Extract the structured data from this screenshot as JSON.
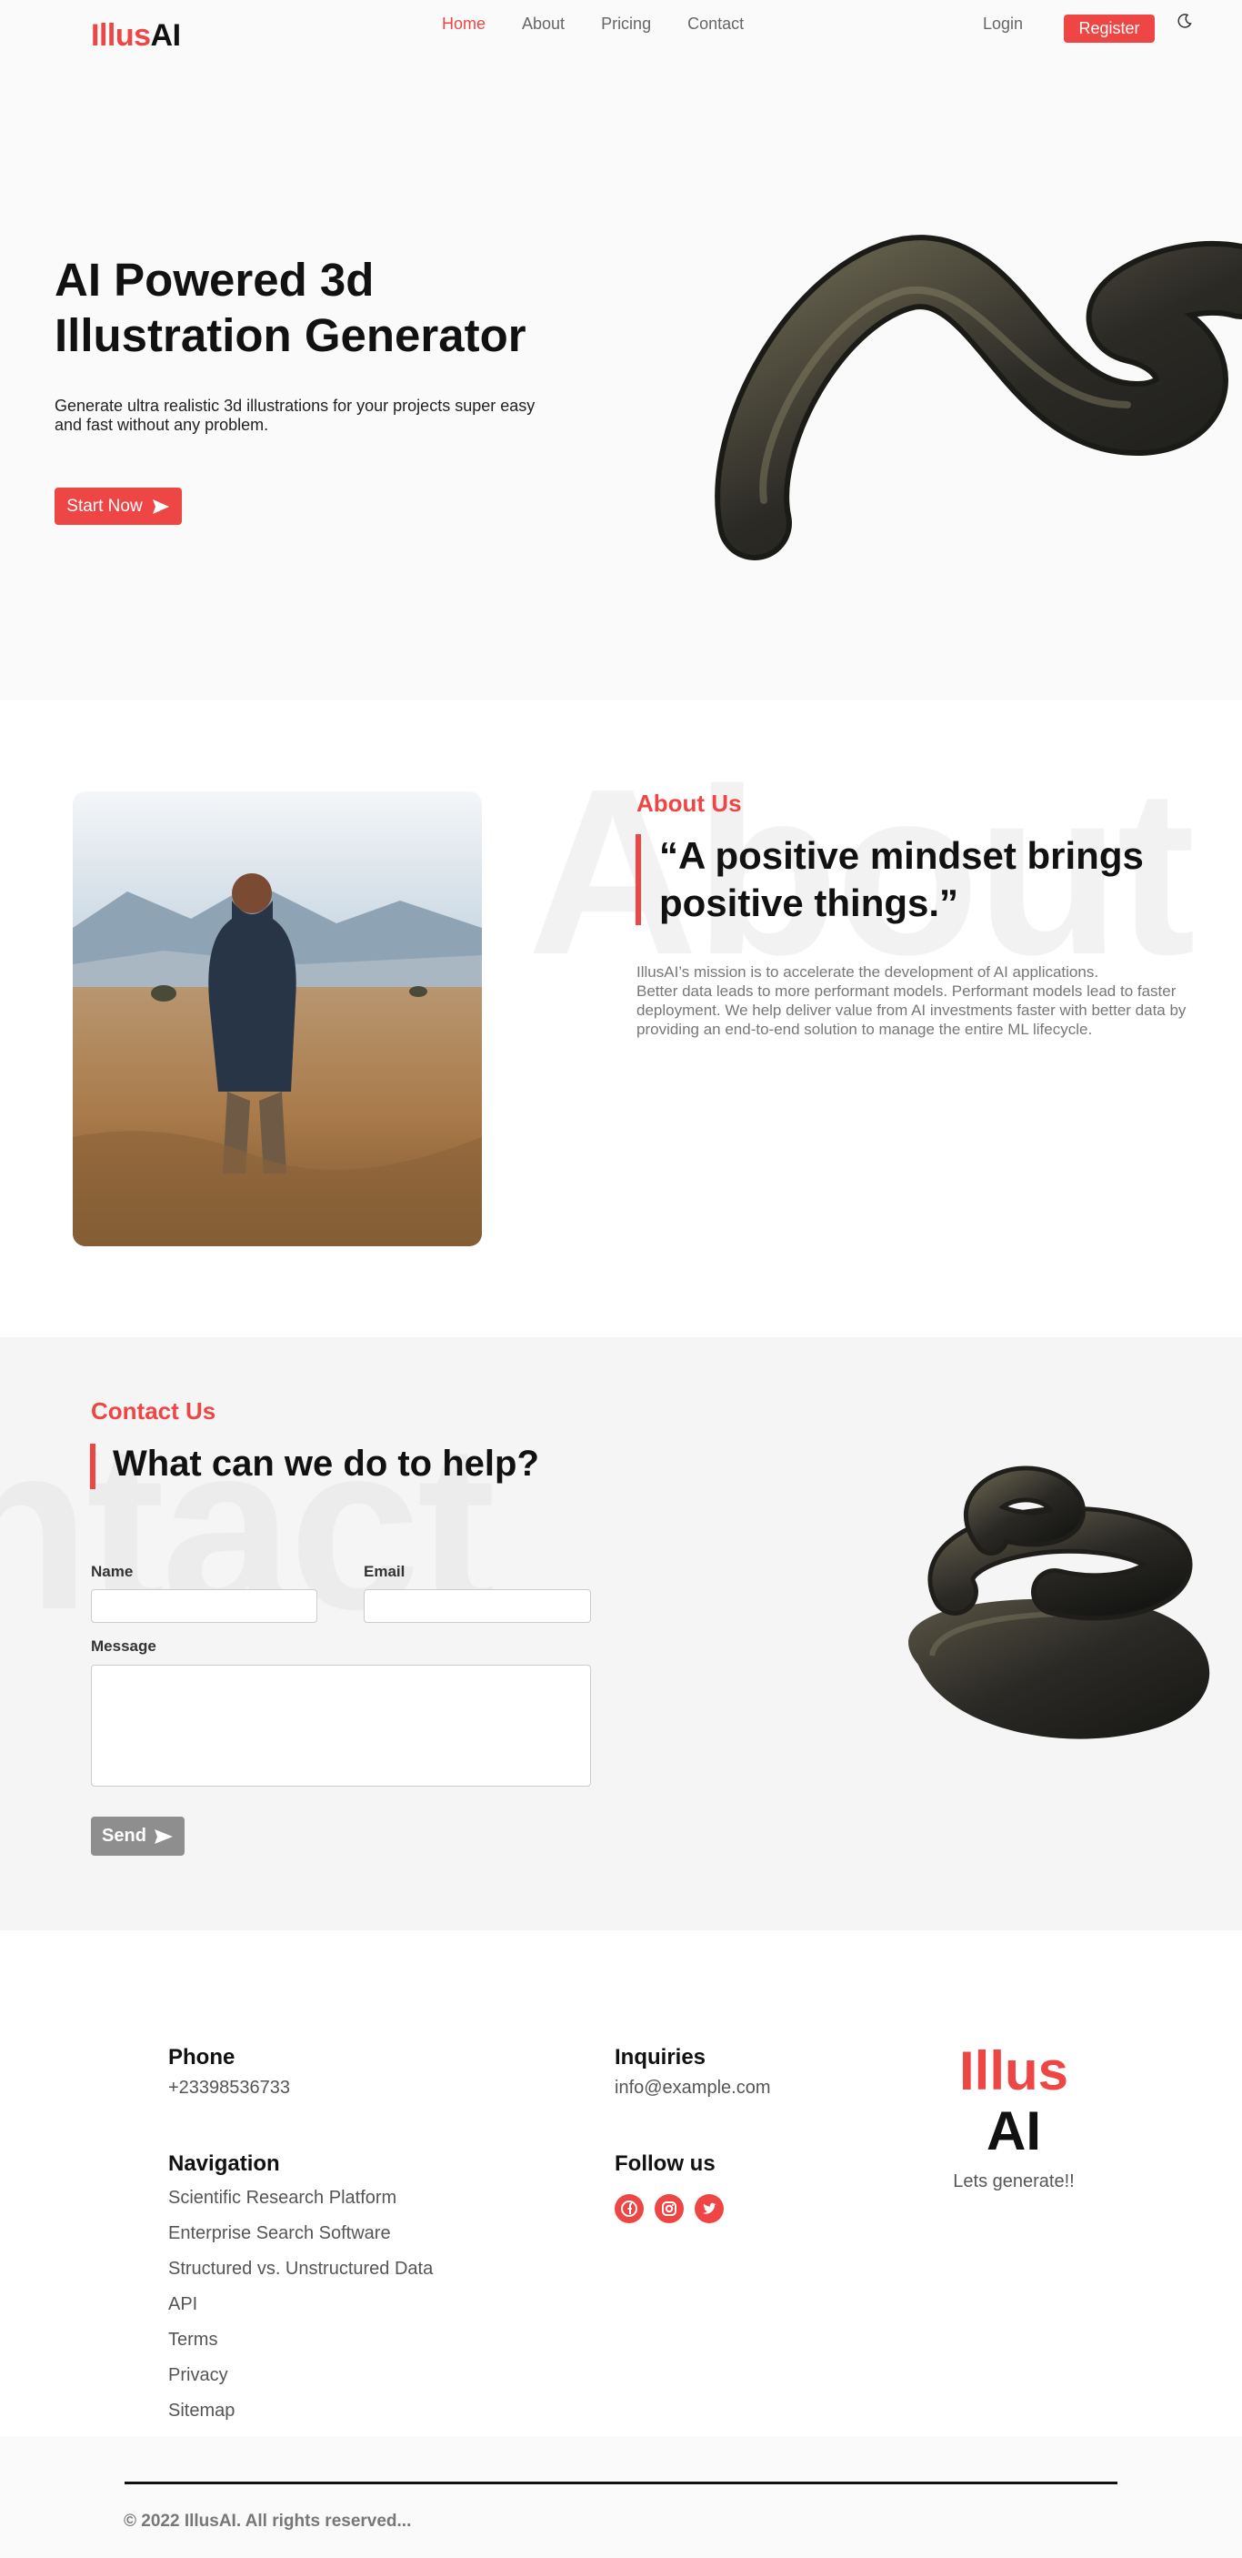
{
  "nav": {
    "logo_red": "Illus",
    "logo_dark": "AI",
    "links": [
      "Home",
      "About",
      "Pricing",
      "Contact"
    ],
    "login": "Login",
    "register": "Register"
  },
  "hero": {
    "title": "AI Powered 3d Illustration Generator",
    "description": "Generate ultra realistic 3d illustrations for your projects super easy and fast without any problem.",
    "cta": "Start Now"
  },
  "about": {
    "watermark": "About",
    "label": "About Us",
    "quote": "“A positive mindset brings positive things.”",
    "text_line1": "IllusAI’s mission is to accelerate the development of AI applications.",
    "text_line2": "Better data leads to more performant models. Performant models lead to faster deployment. We help deliver value from AI investments faster with better data by providing an end-to-end solution to manage the entire ML lifecycle."
  },
  "contact": {
    "watermark": "ntact",
    "label": "Contact Us",
    "heading": "What can we do to help?",
    "name_label": "Name",
    "email_label": "Email",
    "message_label": "Message",
    "send": "Send"
  },
  "footer": {
    "phone_heading": "Phone",
    "phone": "+23398536733",
    "inquiries_heading": "Inquiries",
    "email": "info@example.com",
    "navigation_heading": "Navigation",
    "navigation": [
      "Scientific Research Platform",
      "Enterprise Search Software",
      "Structured vs. Unstructured Data",
      "API",
      "Terms",
      "Privacy",
      "Sitemap"
    ],
    "follow_heading": "Follow us",
    "social_icons": [
      "facebook-icon",
      "instagram-icon",
      "twitter-icon"
    ],
    "logo_red": "Illus",
    "logo_dark": "AI",
    "tagline": "Lets generate!!",
    "copyright": "© 2022 IllusAI. All rights reserved..."
  },
  "colors": {
    "accent": "#ee4545",
    "text": "#111111",
    "muted": "#777777",
    "send_button": "#8e8e8e"
  }
}
